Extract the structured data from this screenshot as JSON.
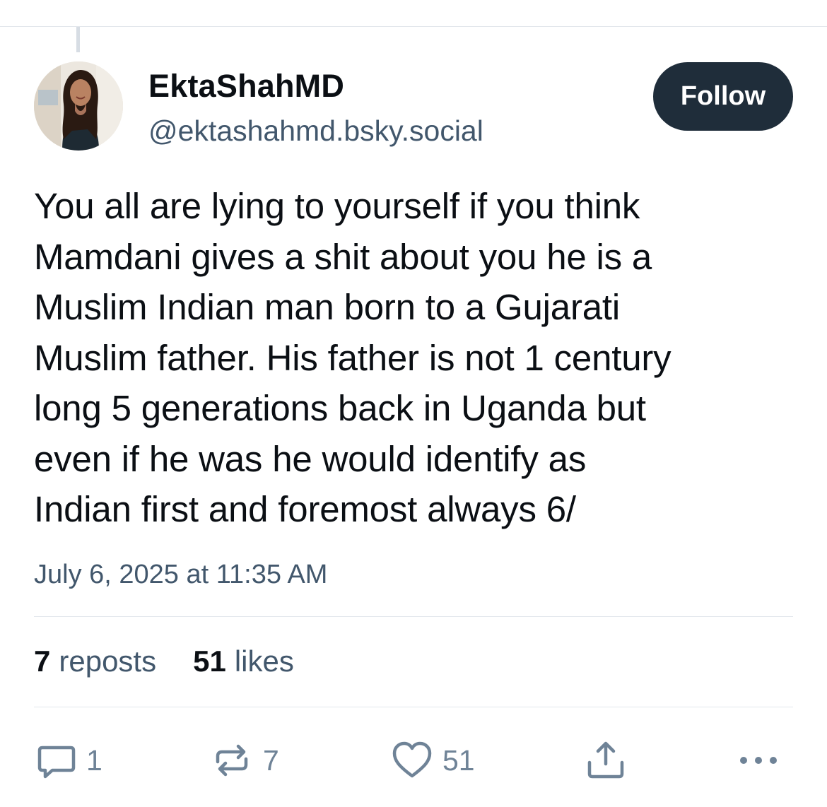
{
  "author": {
    "display_name": "EktaShahMD",
    "handle": "@ektashahmd.bsky.social",
    "avatar_icon": "profile-photo"
  },
  "follow_label": "Follow",
  "post": {
    "lines": [
      "You all are lying to yourself if you think",
      "Mamdani gives a shit about you he is a",
      "Muslim Indian man born to a Gujarati",
      "Muslim father. His father is not 1 century",
      "long 5 generations back in Uganda but",
      "even if he was he would identify as",
      "Indian first and foremost always 6/"
    ],
    "timestamp": "July 6, 2025 at 11:35 AM"
  },
  "stats": {
    "reposts_count": "7",
    "reposts_label": "reposts",
    "likes_count": "51",
    "likes_label": "likes"
  },
  "actions": {
    "reply_count": "1",
    "repost_count": "7",
    "like_count": "51",
    "reply_icon": "reply-icon",
    "repost_icon": "repost-icon",
    "like_icon": "heart-icon",
    "share_icon": "share-icon",
    "more_icon": "more-icon"
  },
  "colors": {
    "text": "#0b0f14",
    "secondary_text": "#42576c",
    "icon": "#6f8397",
    "follow_bg": "#1f2d3a",
    "divider": "#e3e7ec"
  }
}
